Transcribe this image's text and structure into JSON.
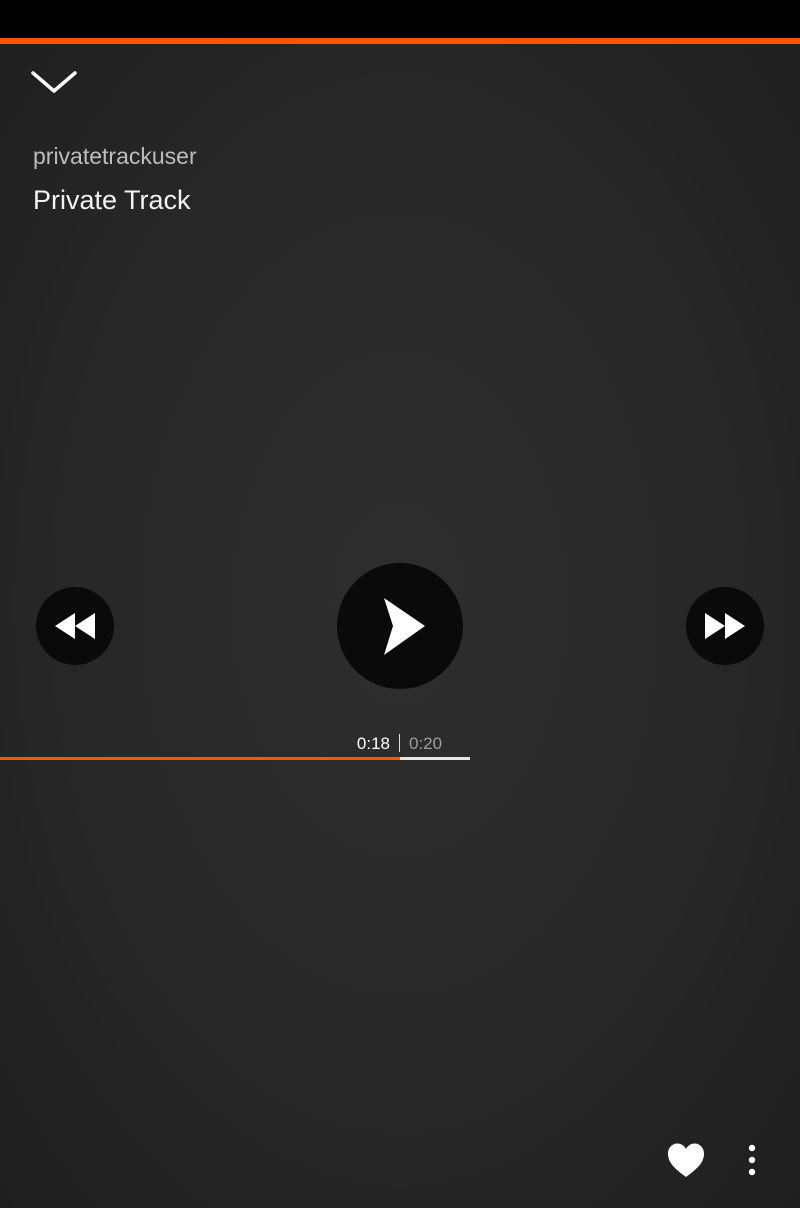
{
  "player": {
    "username": "privatetrackuser",
    "track_title": "Private Track",
    "time_current": "0:18",
    "time_total": "0:20",
    "progress_fraction": 0.85
  },
  "icons": {
    "collapse": "chevron-down-icon",
    "rewind": "rewind-icon",
    "play": "play-icon",
    "forward": "fast-forward-icon",
    "like": "heart-icon",
    "more": "more-vertical-icon"
  },
  "colors": {
    "accent": "#ff5500",
    "background": "#2a2a2a",
    "button_bg": "#0a0a0a"
  }
}
